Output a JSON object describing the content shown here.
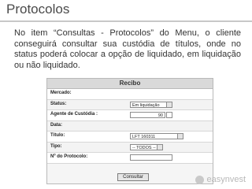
{
  "slide": {
    "title": "Protocolos",
    "body": "No item “Consultas - Protocolos” do Menu, o cliente conseguirá consultar sua custódia de títulos, onde no status poderá colocar a opção de liquidado, em liquidação ou não liquidado."
  },
  "form": {
    "header": "Recibo",
    "fields": {
      "mercado": {
        "label": "Mercado:"
      },
      "status": {
        "label": "Status:",
        "value": "Em liquidação"
      },
      "agente": {
        "label": "Agente de Custódia :",
        "value": "90"
      },
      "data": {
        "label": "Data:"
      },
      "titulo": {
        "label": "Título:",
        "value": "LFT 160311"
      },
      "tipo": {
        "label": "Tipo:",
        "value": "-- TODOS --"
      },
      "protocolo": {
        "label": "Nº do Protocolo:"
      }
    },
    "submit_label": "Consultar"
  },
  "logo": {
    "text": "easynvest"
  }
}
